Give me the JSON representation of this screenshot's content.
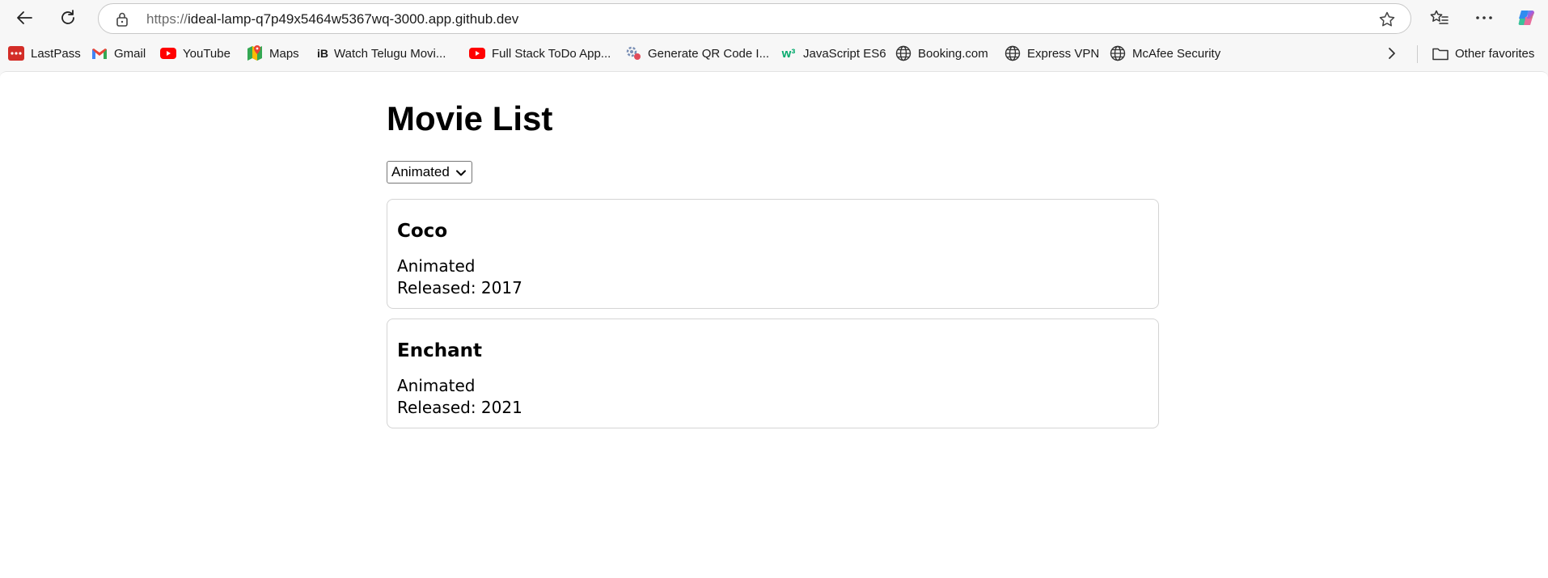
{
  "browser": {
    "url_proto": "https://",
    "url_rest": "ideal-lamp-q7p49x5464w5367wq-3000.app.github.dev"
  },
  "bookmarks": [
    {
      "label": "LastPass",
      "icon": "lastpass-icon"
    },
    {
      "label": "Gmail",
      "icon": "gmail-icon"
    },
    {
      "label": "YouTube",
      "icon": "youtube-icon"
    },
    {
      "label": "Maps",
      "icon": "maps-icon"
    },
    {
      "label": "Watch Telugu Movi...",
      "icon": "ib-icon"
    },
    {
      "label": "Full Stack ToDo App...",
      "icon": "youtube-icon"
    },
    {
      "label": "Generate QR Code I...",
      "icon": "qr-gear-icon"
    },
    {
      "label": "JavaScript ES6",
      "icon": "w3-icon"
    },
    {
      "label": "Booking.com",
      "icon": "globe-icon"
    },
    {
      "label": "Express VPN",
      "icon": "globe-icon"
    },
    {
      "label": "McAfee Security",
      "icon": "globe-icon"
    }
  ],
  "other_favorites": "Other favorites",
  "page": {
    "title": "Movie List",
    "filter_value": "Animated"
  },
  "movies": [
    {
      "title": "Coco",
      "genre": "Animated",
      "released": "Released: 2017"
    },
    {
      "title": "Enchant",
      "genre": "Animated",
      "released": "Released: 2021"
    }
  ]
}
